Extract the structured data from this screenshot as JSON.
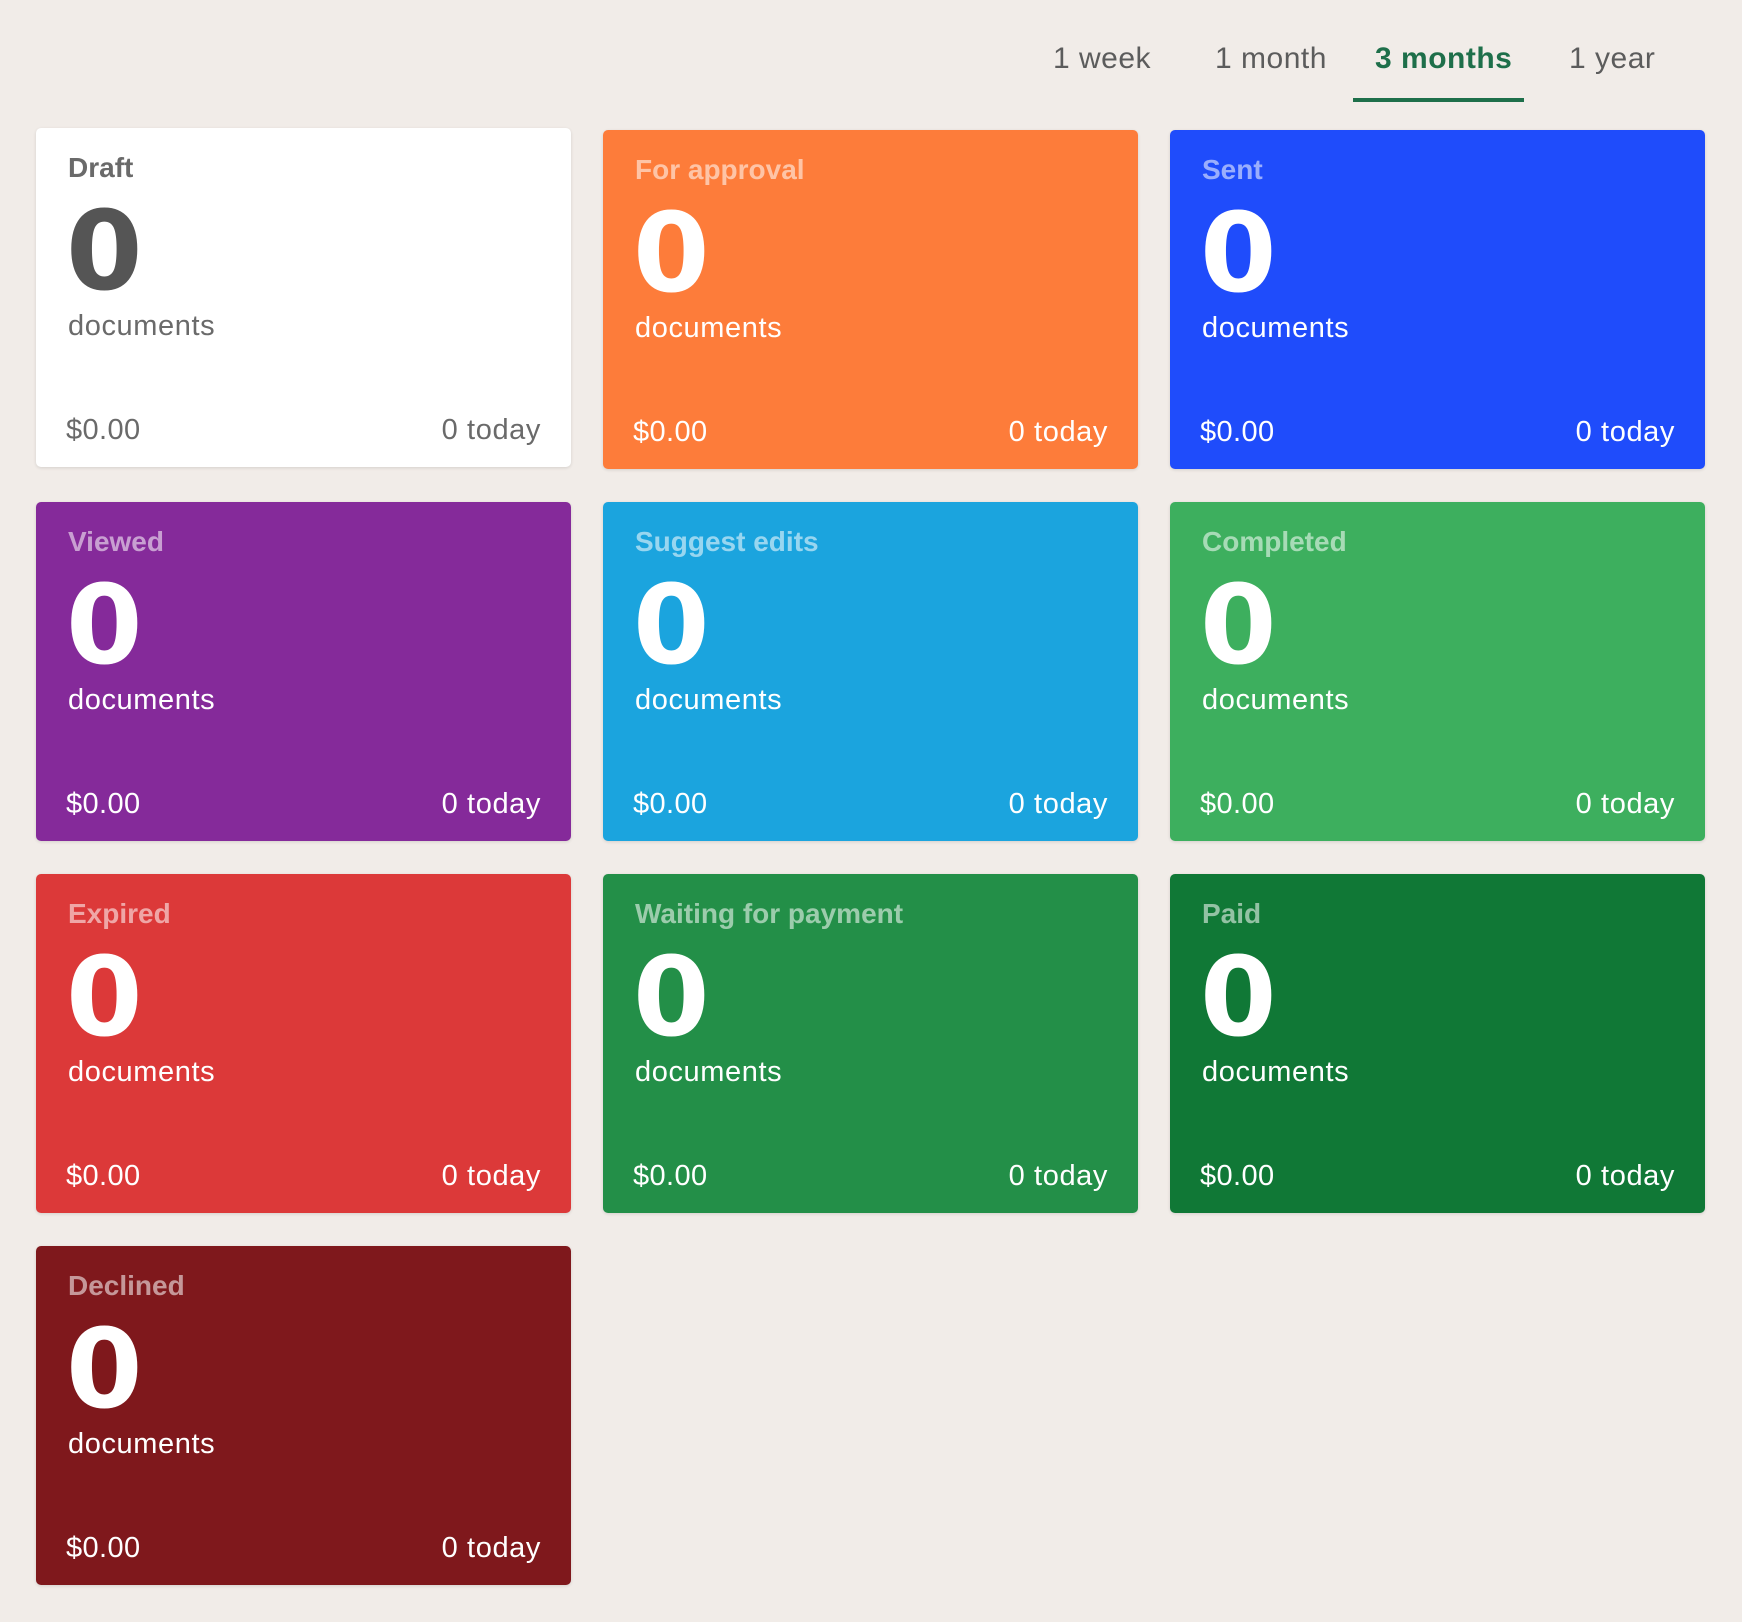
{
  "period_tabs": {
    "items": [
      {
        "label": "1 week"
      },
      {
        "label": "1 month"
      },
      {
        "label": "3 months"
      },
      {
        "label": "1 year"
      }
    ],
    "selected": "3 months",
    "accent_color": "#1e6f4a"
  },
  "cards": [
    {
      "title": "Draft",
      "count": "0",
      "unit": "documents",
      "amount": "$0.00",
      "today": "0 today",
      "color": "#ffffff"
    },
    {
      "title": "For approval",
      "count": "0",
      "unit": "documents",
      "amount": "$0.00",
      "today": "0 today",
      "color": "#fd7c3a"
    },
    {
      "title": "Sent",
      "count": "0",
      "unit": "documents",
      "amount": "$0.00",
      "today": "0 today",
      "color": "#1f4cfb"
    },
    {
      "title": "Viewed",
      "count": "0",
      "unit": "documents",
      "amount": "$0.00",
      "today": "0 today",
      "color": "#852a9a"
    },
    {
      "title": "Suggest edits",
      "count": "0",
      "unit": "documents",
      "amount": "$0.00",
      "today": "0 today",
      "color": "#1ba4de"
    },
    {
      "title": "Completed",
      "count": "0",
      "unit": "documents",
      "amount": "$0.00",
      "today": "0 today",
      "color": "#3daf5e"
    },
    {
      "title": "Expired",
      "count": "0",
      "unit": "documents",
      "amount": "$0.00",
      "today": "0 today",
      "color": "#dc3939"
    },
    {
      "title": "Waiting for payment",
      "count": "0",
      "unit": "documents",
      "amount": "$0.00",
      "today": "0 today",
      "color": "#238f48"
    },
    {
      "title": "Paid",
      "count": "0",
      "unit": "documents",
      "amount": "$0.00",
      "today": "0 today",
      "color": "#107836"
    },
    {
      "title": "Declined",
      "count": "0",
      "unit": "documents",
      "amount": "$0.00",
      "today": "0 today",
      "color": "#7f181c"
    }
  ]
}
